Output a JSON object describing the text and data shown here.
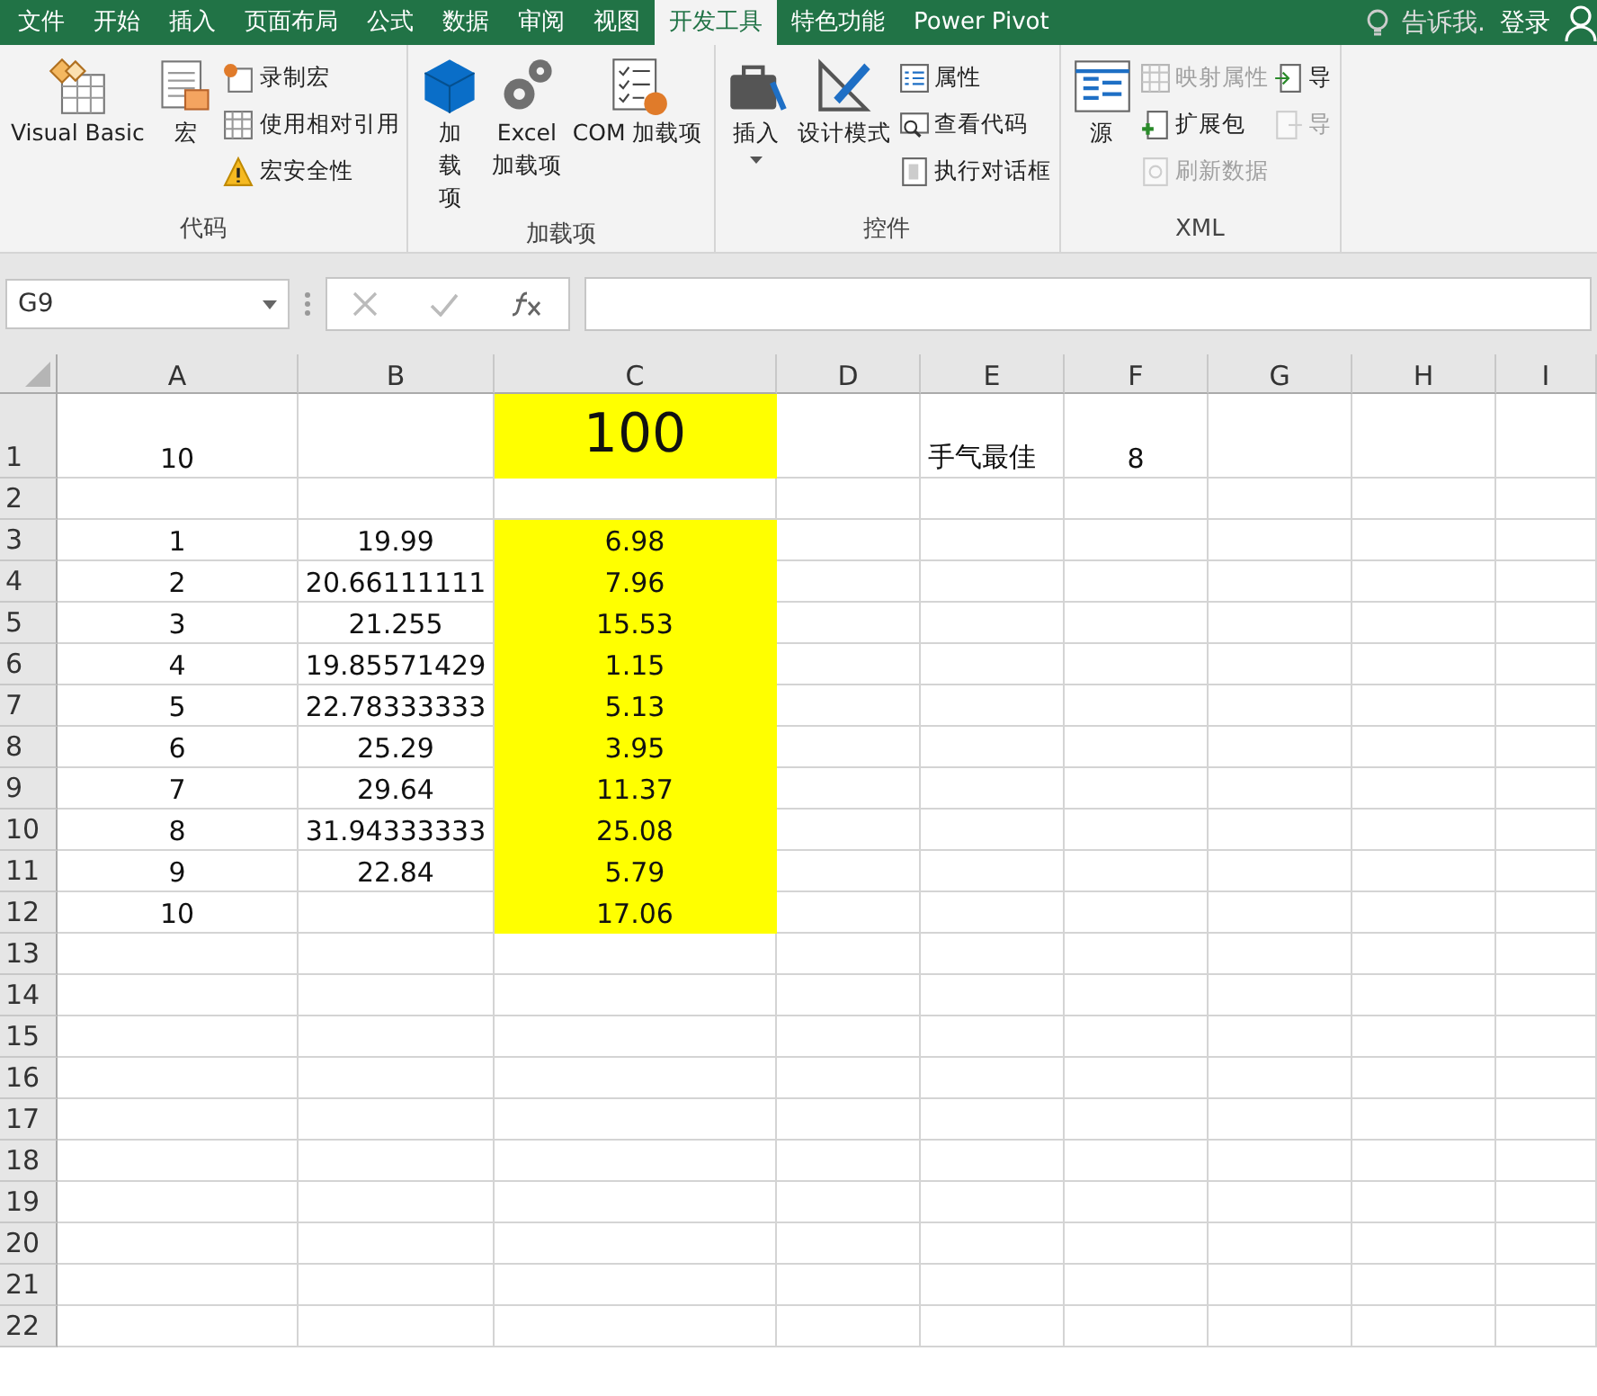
{
  "tabs": [
    {
      "label": "文件",
      "selected": false
    },
    {
      "label": "开始",
      "selected": false
    },
    {
      "label": "插入",
      "selected": false
    },
    {
      "label": "页面布局",
      "selected": false
    },
    {
      "label": "公式",
      "selected": false
    },
    {
      "label": "数据",
      "selected": false
    },
    {
      "label": "审阅",
      "selected": false
    },
    {
      "label": "视图",
      "selected": false
    },
    {
      "label": "开发工具",
      "selected": true
    },
    {
      "label": "特色功能",
      "selected": false
    },
    {
      "label": "Power Pivot",
      "selected": false
    }
  ],
  "tell_me": "告诉我.",
  "sign_in": "登录",
  "ribbon_groups": [
    {
      "label": "代码",
      "items": [
        {
          "kind": "large",
          "label": "Visual Basic",
          "disabled": false
        },
        {
          "kind": "large",
          "label": "宏",
          "disabled": false
        },
        {
          "kind": "stack",
          "items": [
            {
              "label": "录制宏",
              "disabled": false
            },
            {
              "label": "使用相对引用",
              "disabled": false
            },
            {
              "label": "宏安全性",
              "disabled": false
            }
          ]
        }
      ]
    },
    {
      "label": "加载项",
      "items": [
        {
          "kind": "large",
          "label": "加载项",
          "disabled": false
        },
        {
          "kind": "large",
          "label": "Excel\n加载项",
          "disabled": false
        },
        {
          "kind": "large",
          "label": "COM 加载项",
          "disabled": false
        }
      ]
    },
    {
      "label": "控件",
      "items": [
        {
          "kind": "large",
          "label": "插入",
          "dropdown": true,
          "disabled": false
        },
        {
          "kind": "large",
          "label": "设计模式",
          "disabled": false
        },
        {
          "kind": "stack",
          "items": [
            {
              "label": "属性",
              "disabled": false
            },
            {
              "label": "查看代码",
              "disabled": false
            },
            {
              "label": "执行对话框",
              "disabled": false
            }
          ]
        }
      ]
    },
    {
      "label": "XML",
      "items": [
        {
          "kind": "large",
          "label": "源",
          "disabled": false
        },
        {
          "kind": "stack",
          "items": [
            {
              "label": "映射属性",
              "disabled": true
            },
            {
              "label": "扩展包",
              "disabled": false
            },
            {
              "label": "刷新数据",
              "disabled": true
            }
          ]
        },
        {
          "kind": "stack",
          "items": [
            {
              "label": "导",
              "disabled": false
            },
            {
              "label": "导",
              "disabled": true
            }
          ]
        }
      ]
    }
  ],
  "name_box": "G9",
  "columns": [
    "A",
    "B",
    "C",
    "D",
    "E",
    "F",
    "G",
    "H",
    "I"
  ],
  "rows": [
    {
      "label": "1",
      "tall": true,
      "c_highlighted": true,
      "cells": [
        "10",
        "",
        "100",
        "",
        "手气最佳",
        "8",
        "",
        "",
        ""
      ]
    },
    {
      "label": "2",
      "tall": false,
      "c_highlighted": false,
      "cells": [
        "",
        "",
        "",
        "",
        "",
        "",
        "",
        "",
        ""
      ]
    },
    {
      "label": "3",
      "tall": false,
      "c_highlighted": true,
      "cells": [
        "1",
        "19.99",
        "6.98",
        "",
        "",
        "",
        "",
        "",
        ""
      ]
    },
    {
      "label": "4",
      "tall": false,
      "c_highlighted": true,
      "cells": [
        "2",
        "20.66111111",
        "7.96",
        "",
        "",
        "",
        "",
        "",
        ""
      ]
    },
    {
      "label": "5",
      "tall": false,
      "c_highlighted": true,
      "cells": [
        "3",
        "21.255",
        "15.53",
        "",
        "",
        "",
        "",
        "",
        ""
      ]
    },
    {
      "label": "6",
      "tall": false,
      "c_highlighted": true,
      "cells": [
        "4",
        "19.85571429",
        "1.15",
        "",
        "",
        "",
        "",
        "",
        ""
      ]
    },
    {
      "label": "7",
      "tall": false,
      "c_highlighted": true,
      "cells": [
        "5",
        "22.78333333",
        "5.13",
        "",
        "",
        "",
        "",
        "",
        ""
      ]
    },
    {
      "label": "8",
      "tall": false,
      "c_highlighted": true,
      "cells": [
        "6",
        "25.29",
        "3.95",
        "",
        "",
        "",
        "",
        "",
        ""
      ]
    },
    {
      "label": "9",
      "tall": false,
      "c_highlighted": true,
      "cells": [
        "7",
        "29.64",
        "11.37",
        "",
        "",
        "",
        "",
        "",
        ""
      ]
    },
    {
      "label": "10",
      "tall": false,
      "c_highlighted": true,
      "cells": [
        "8",
        "31.94333333",
        "25.08",
        "",
        "",
        "",
        "",
        "",
        ""
      ]
    },
    {
      "label": "11",
      "tall": false,
      "c_highlighted": true,
      "cells": [
        "9",
        "22.84",
        "5.79",
        "",
        "",
        "",
        "",
        "",
        ""
      ]
    },
    {
      "label": "12",
      "tall": false,
      "c_highlighted": true,
      "cells": [
        "10",
        "",
        "17.06",
        "",
        "",
        "",
        "",
        "",
        ""
      ]
    },
    {
      "label": "13",
      "tall": false,
      "c_highlighted": false,
      "cells": [
        "",
        "",
        "",
        "",
        "",
        "",
        "",
        "",
        ""
      ]
    },
    {
      "label": "14",
      "tall": false,
      "c_highlighted": false,
      "cells": [
        "",
        "",
        "",
        "",
        "",
        "",
        "",
        "",
        ""
      ]
    },
    {
      "label": "15",
      "tall": false,
      "c_highlighted": false,
      "cells": [
        "",
        "",
        "",
        "",
        "",
        "",
        "",
        "",
        ""
      ]
    },
    {
      "label": "16",
      "tall": false,
      "c_highlighted": false,
      "cells": [
        "",
        "",
        "",
        "",
        "",
        "",
        "",
        "",
        ""
      ]
    },
    {
      "label": "17",
      "tall": false,
      "c_highlighted": false,
      "cells": [
        "",
        "",
        "",
        "",
        "",
        "",
        "",
        "",
        ""
      ]
    },
    {
      "label": "18",
      "tall": false,
      "c_highlighted": false,
      "cells": [
        "",
        "",
        "",
        "",
        "",
        "",
        "",
        "",
        ""
      ]
    },
    {
      "label": "19",
      "tall": false,
      "c_highlighted": false,
      "cells": [
        "",
        "",
        "",
        "",
        "",
        "",
        "",
        "",
        ""
      ]
    },
    {
      "label": "20",
      "tall": false,
      "c_highlighted": false,
      "cells": [
        "",
        "",
        "",
        "",
        "",
        "",
        "",
        "",
        ""
      ]
    },
    {
      "label": "21",
      "tall": false,
      "c_highlighted": false,
      "cells": [
        "",
        "",
        "",
        "",
        "",
        "",
        "",
        "",
        ""
      ]
    },
    {
      "label": "22",
      "tall": false,
      "c_highlighted": false,
      "cells": [
        "",
        "",
        "",
        "",
        "",
        "",
        "",
        "",
        ""
      ]
    }
  ]
}
